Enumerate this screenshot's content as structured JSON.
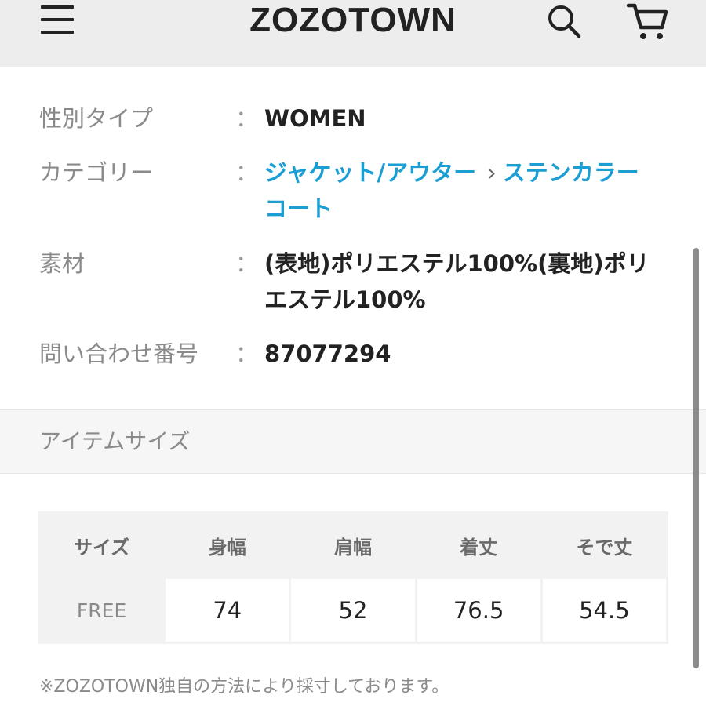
{
  "header": {
    "logo": "ZOZOTOWN",
    "menu_icon": "hamburger-menu-icon",
    "search_icon": "search-icon",
    "cart_icon": "cart-icon"
  },
  "details": {
    "colon": "：",
    "gender": {
      "label": "性別タイプ",
      "value": "WOMEN"
    },
    "category": {
      "label": "カテゴリー",
      "primary": "ジャケット/アウター",
      "separator": "›",
      "secondary": "ステンカラーコート"
    },
    "material": {
      "label": "素材",
      "value": "(表地)ポリエステル100%(裏地)ポリエステル100%"
    },
    "inquiry": {
      "label": "問い合わせ番号",
      "value": "87077294"
    }
  },
  "item_size": {
    "title": "アイテムサイズ",
    "headers": [
      "サイズ",
      "身幅",
      "肩幅",
      "着丈",
      "そで丈"
    ],
    "row": {
      "size": "FREE",
      "values": [
        "74",
        "52",
        "76.5",
        "54.5"
      ]
    },
    "note": "※ZOZOTOWN独自の方法により採寸しております。"
  },
  "colors": {
    "link": "#1a9ed4",
    "header_bg": "#ededed"
  }
}
